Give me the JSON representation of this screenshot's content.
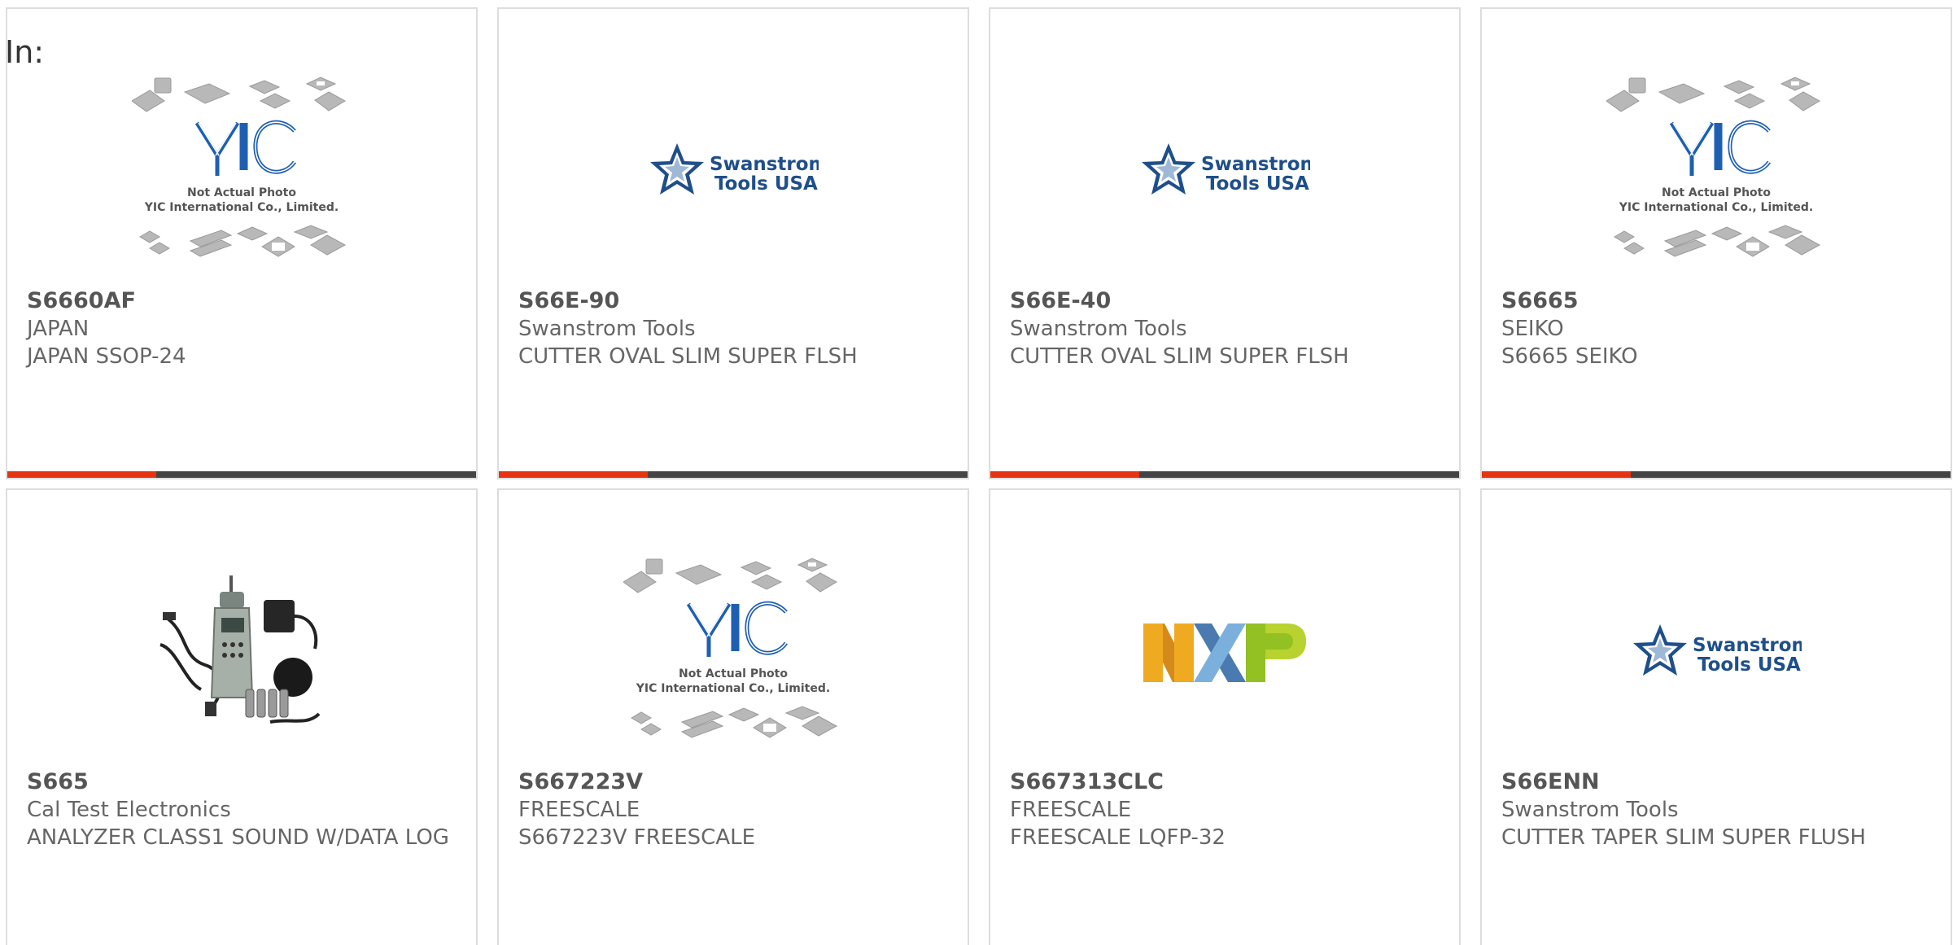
{
  "header": {
    "label": "In:"
  },
  "accent_color": "#e63312",
  "bar_color": "#444444",
  "products": [
    {
      "part": "S6660AF",
      "manufacturer": "JAPAN",
      "description": "JAPAN SSOP-24",
      "image": "yic-placeholder",
      "image_text": {
        "line1": "Not Actual Photo",
        "line2": "YIC International Co., Limited."
      }
    },
    {
      "part": "S66E-90",
      "manufacturer": "Swanstrom Tools",
      "description": "CUTTER OVAL SLIM SUPER FLSH",
      "image": "swanstrom-logo",
      "image_text": {
        "line1": "Swanstrom",
        "line2": "Tools USA"
      }
    },
    {
      "part": "S66E-40",
      "manufacturer": "Swanstrom Tools",
      "description": "CUTTER OVAL SLIM SUPER FLSH",
      "image": "swanstrom-logo",
      "image_text": {
        "line1": "Swanstrom",
        "line2": "Tools USA"
      }
    },
    {
      "part": "S6665",
      "manufacturer": "SEIKO",
      "description": "S6665 SEIKO",
      "image": "yic-placeholder",
      "image_text": {
        "line1": "Not Actual Photo",
        "line2": "YIC International Co., Limited."
      }
    },
    {
      "part": "S665",
      "manufacturer": "Cal Test Electronics",
      "description": "ANALYZER CLASS1 SOUND W/DATA LOG",
      "image": "sound-analyzer-photo"
    },
    {
      "part": "S667223V",
      "manufacturer": "FREESCALE",
      "description": "S667223V FREESCALE",
      "image": "yic-placeholder",
      "image_text": {
        "line1": "Not Actual Photo",
        "line2": "YIC International Co., Limited."
      }
    },
    {
      "part": "S667313CLC",
      "manufacturer": "FREESCALE",
      "description": "FREESCALE LQFP-32",
      "image": "nxp-logo"
    },
    {
      "part": "S66ENN",
      "manufacturer": "Swanstrom Tools",
      "description": "CUTTER TAPER SLIM SUPER FLUSH",
      "image": "swanstrom-logo",
      "image_text": {
        "line1": "Swanstrom",
        "line2": "Tools USA"
      }
    }
  ]
}
